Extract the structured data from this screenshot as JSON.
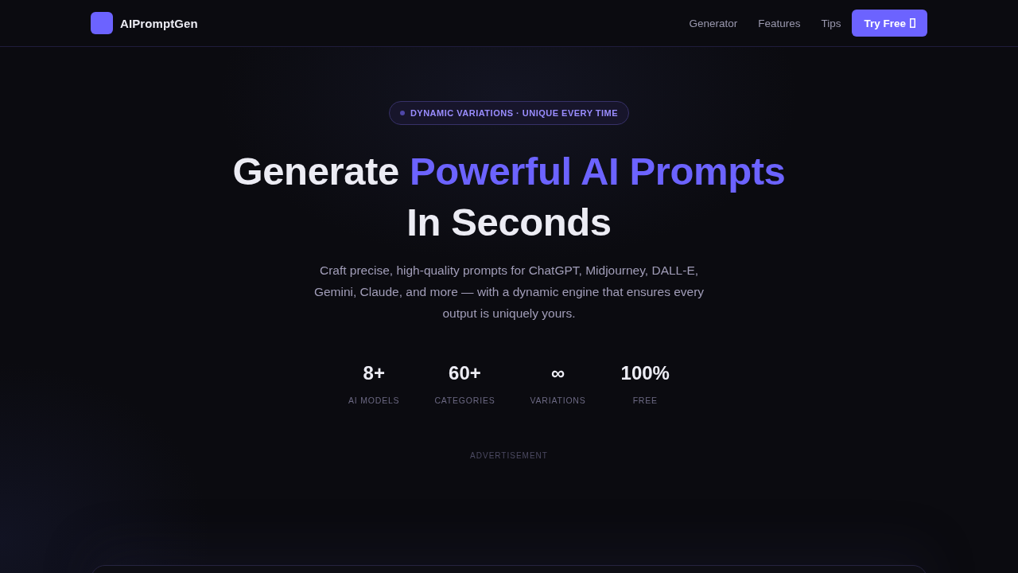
{
  "header": {
    "brand": "AIPromptGen",
    "nav": [
      "Generator",
      "Features",
      "Tips"
    ],
    "cta": "Try Free"
  },
  "hero": {
    "badge": "DYNAMIC VARIATIONS · UNIQUE EVERY TIME",
    "heading": {
      "lead": "Generate ",
      "highlight": "Powerful AI Prompts",
      "tail": "In Seconds"
    },
    "subtitle": "Craft precise, high-quality prompts for ChatGPT, Midjourney, DALL-E, Gemini, Claude, and more — with a dynamic engine that ensures every output is uniquely yours.",
    "stats": [
      {
        "value": "8+",
        "label": "AI MODELS"
      },
      {
        "value": "60+",
        "label": "CATEGORIES"
      },
      {
        "value": "∞",
        "label": "VARIATIONS"
      },
      {
        "value": "100%",
        "label": "FREE"
      }
    ]
  },
  "ad": {
    "label": "ADVERTISEMENT"
  }
}
